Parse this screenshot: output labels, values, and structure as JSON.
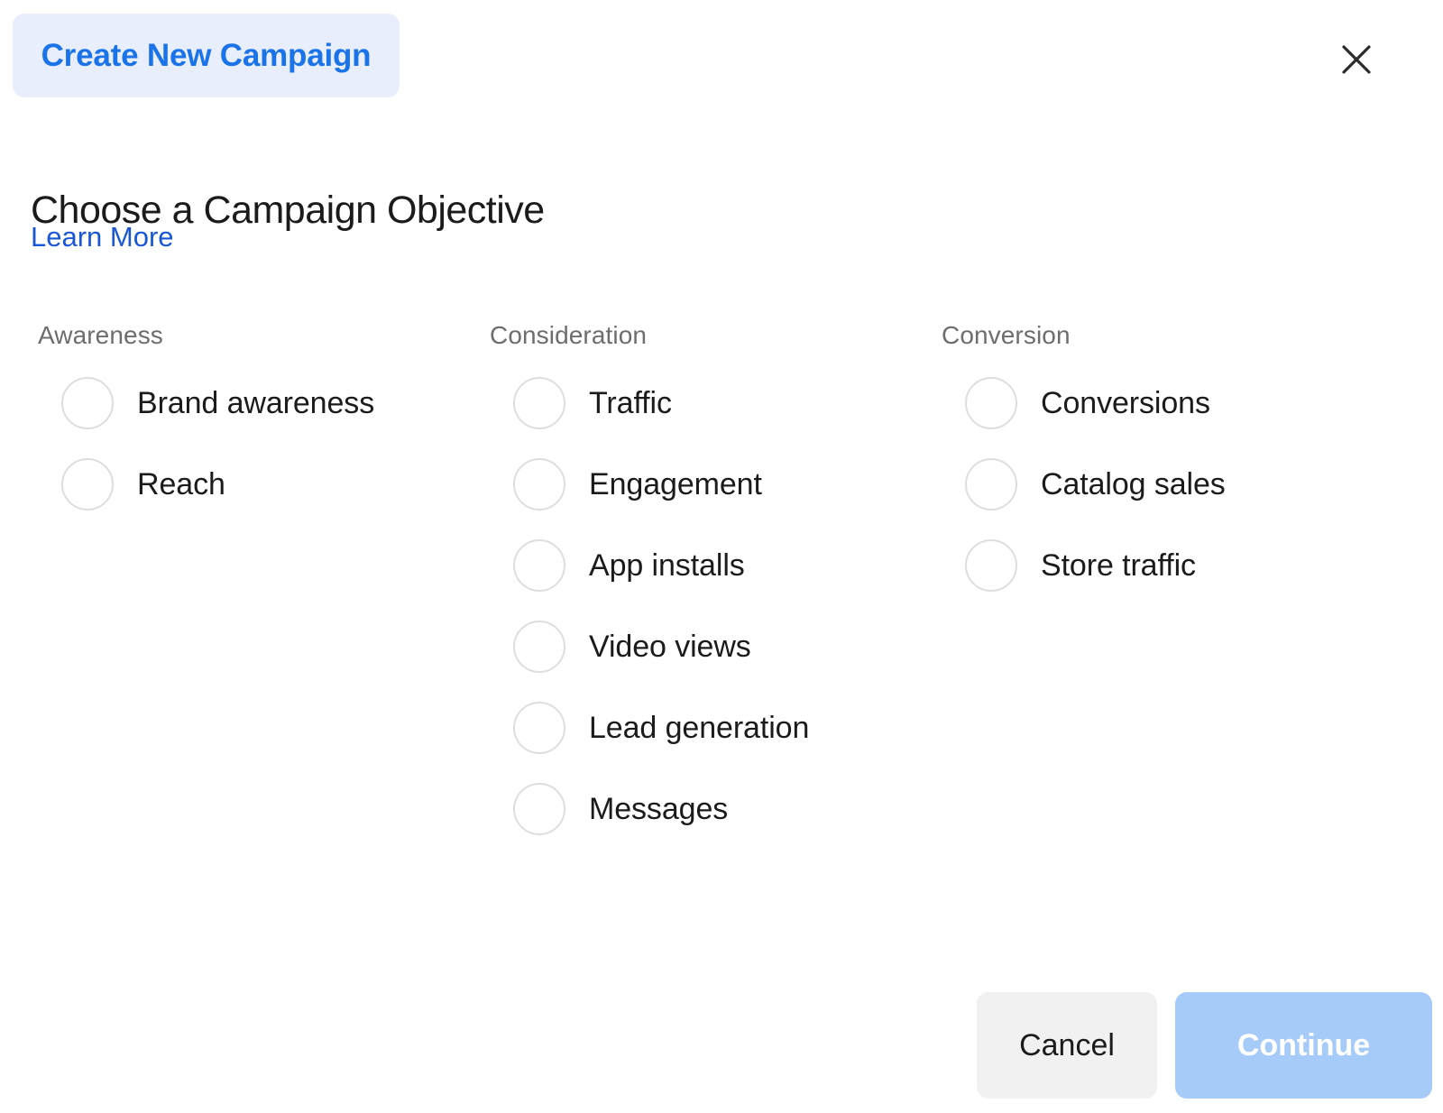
{
  "header": {
    "badge_label": "Create New Campaign",
    "close_icon": "close-icon"
  },
  "title": "Choose a Campaign Objective",
  "learn_more_label": "Learn More",
  "columns": [
    {
      "header": "Awareness",
      "options": [
        {
          "label": "Brand awareness",
          "selected": false
        },
        {
          "label": "Reach",
          "selected": false
        }
      ]
    },
    {
      "header": "Consideration",
      "options": [
        {
          "label": "Traffic",
          "selected": false
        },
        {
          "label": "Engagement",
          "selected": false
        },
        {
          "label": "App installs",
          "selected": false
        },
        {
          "label": "Video views",
          "selected": false
        },
        {
          "label": "Lead generation",
          "selected": false
        },
        {
          "label": "Messages",
          "selected": false
        }
      ]
    },
    {
      "header": "Conversion",
      "options": [
        {
          "label": "Conversions",
          "selected": false
        },
        {
          "label": "Catalog sales",
          "selected": false
        },
        {
          "label": "Store traffic",
          "selected": false
        }
      ]
    }
  ],
  "footer": {
    "cancel_label": "Cancel",
    "continue_label": "Continue"
  },
  "colors": {
    "accent_blue": "#1a73e8",
    "link_blue": "#1a57d6",
    "badge_background": "#e8eefc",
    "continue_background": "#a6cbf8",
    "cancel_background": "#f1f1f1",
    "radio_border": "#dedede",
    "header_text": "#6d6d6d",
    "body_text": "#1b1b1b"
  }
}
